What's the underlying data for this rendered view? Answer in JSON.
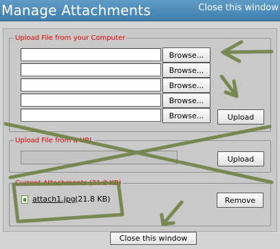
{
  "window": {
    "title": "Manage Attachments",
    "close_top_label": "Close this window",
    "close_bottom_label": "Close this window"
  },
  "upload_computer": {
    "legend": "Upload File from your Computer",
    "file_inputs": [
      {
        "value": "",
        "browse_label": "Browse..."
      },
      {
        "value": "",
        "browse_label": "Browse..."
      },
      {
        "value": "",
        "browse_label": "Browse..."
      },
      {
        "value": "",
        "browse_label": "Browse..."
      },
      {
        "value": "",
        "browse_label": "Browse..."
      }
    ],
    "upload_label": "Upload"
  },
  "upload_url": {
    "legend": "Upload File from a URL",
    "url_value": "",
    "upload_label": "Upload"
  },
  "current_attachments": {
    "legend": "Current Attachments (21.8 KB)",
    "items": [
      {
        "name": "attach1.jpg",
        "size": "(21.8 KB)",
        "remove_label": "Remove"
      }
    ]
  },
  "colors": {
    "title_bar": "#4a88b8",
    "legend_text": "#e00000",
    "annotation": "#6b7d3d"
  },
  "icons": {
    "attachment": "image-file-icon"
  }
}
